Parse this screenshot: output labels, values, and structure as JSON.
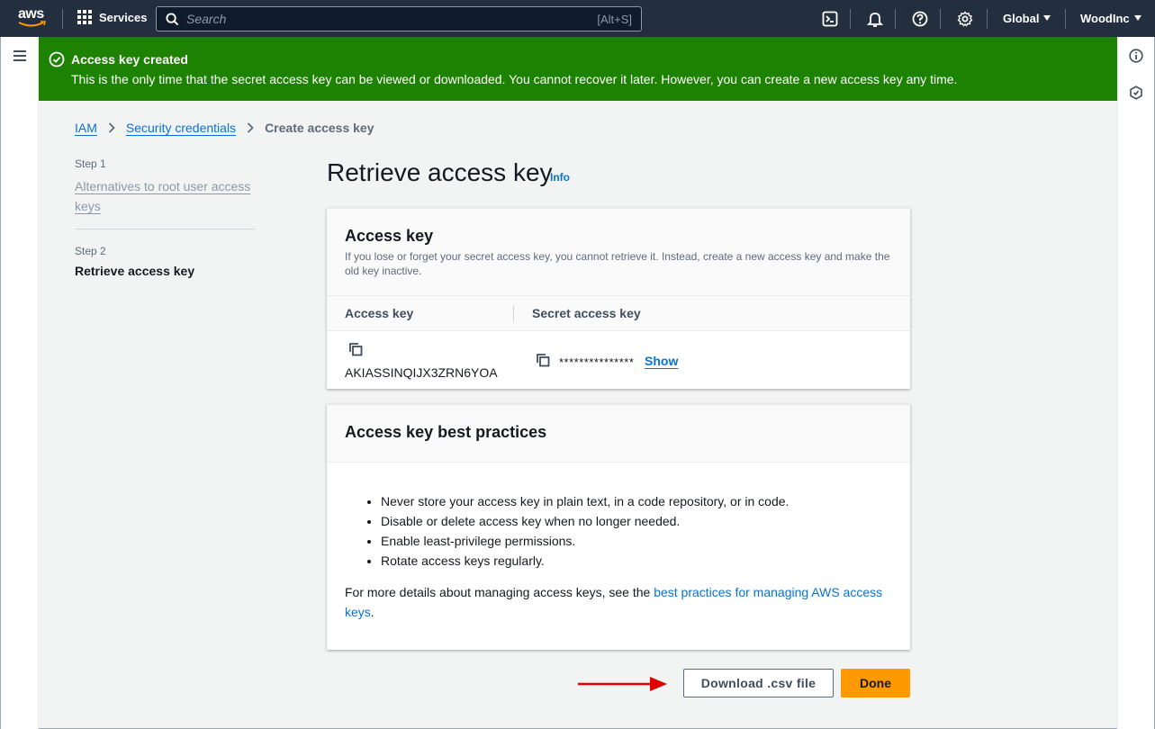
{
  "nav": {
    "logo_text": "aws",
    "services_label": "Services",
    "search_placeholder": "Search",
    "search_shortcut": "[Alt+S]",
    "region_label": "Global",
    "account_label": "WoodInc"
  },
  "flash": {
    "title": "Access key created",
    "message": "This is the only time that the secret access key can be viewed or downloaded. You cannot recover it later. However, you can create a new access key any time.",
    "color": "#1d8102"
  },
  "breadcrumb": {
    "items": [
      "IAM",
      "Security credentials",
      "Create access key"
    ]
  },
  "steps": [
    {
      "label": "Step 1",
      "title": "Alternatives to root user access keys"
    },
    {
      "label": "Step 2",
      "title": "Retrieve access key"
    }
  ],
  "page": {
    "title": "Retrieve access key",
    "info_label": "Info"
  },
  "access_key_card": {
    "title": "Access key",
    "description": "If you lose or forget your secret access key, you cannot retrieve it. Instead, create a new access key and make the old key inactive.",
    "col_access_key": "Access key",
    "col_secret_key": "Secret access key",
    "access_key_id": "AKIASSINQIJX3ZRN6YOA",
    "secret_masked": "***************",
    "show_label": "Show"
  },
  "best_practices_card": {
    "title": "Access key best practices",
    "items": [
      "Never store your access key in plain text, in a code repository, or in code.",
      "Disable or delete access key when no longer needed.",
      "Enable least-privilege permissions.",
      "Rotate access keys regularly."
    ],
    "more_prefix": "For more details about managing access keys, see the ",
    "more_link": "best practices for managing AWS access keys",
    "more_suffix": "."
  },
  "actions": {
    "download_label": "Download .csv file",
    "done_label": "Done"
  },
  "colors": {
    "accent": "#0972d3",
    "primary_button": "#ff9900",
    "nav_bg": "#232f3e",
    "annotation_arrow": "#e00000"
  }
}
